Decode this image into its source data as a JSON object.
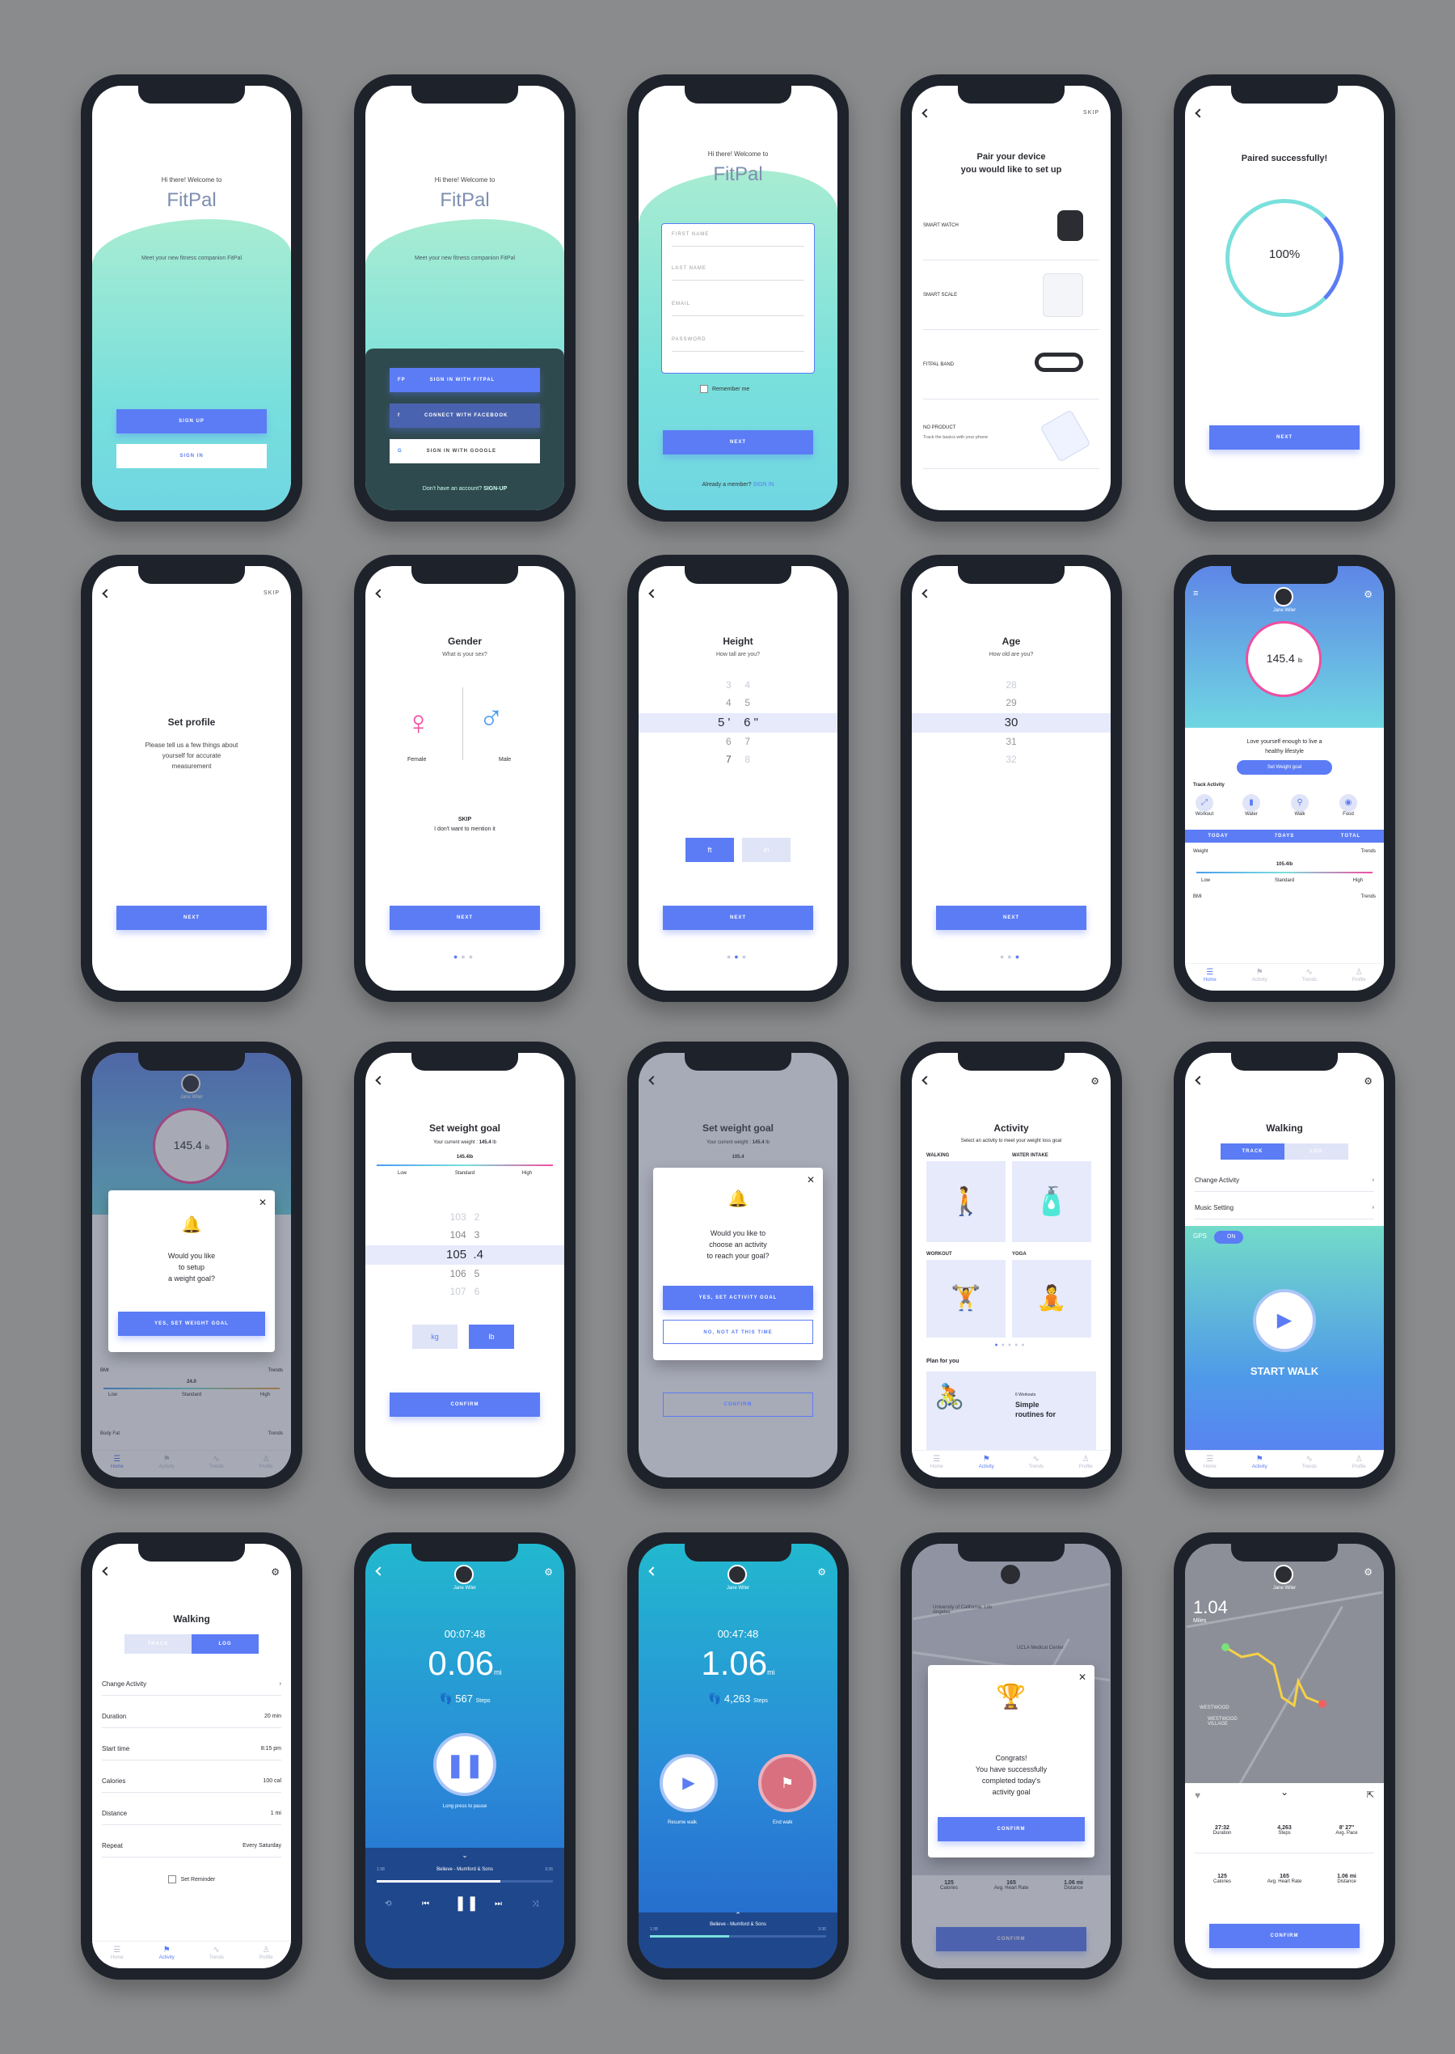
{
  "brand": {
    "name": "FitPal",
    "accent": "#5b7cf5",
    "dark": "#1e222b",
    "teal": "#7ae0dc",
    "pink": "#f04ea0"
  },
  "welcome": {
    "greeting": "Hi there! Welcome to",
    "tagline": "Meet your new fitness companion FitPal",
    "signup": "SIGN UP",
    "signin": "SIGN IN"
  },
  "social": {
    "fitpal_badge": "FP",
    "fitpal": "SIGN IN WITH FITPAL",
    "facebook_badge": "f",
    "facebook": "CONNECT WITH FACEBOOK",
    "google_badge": "G",
    "google": "SIGN IN WITH GOOGLE",
    "no_account": "Don't have an account?",
    "signup_link": "SIGN-UP"
  },
  "signup_form": {
    "first_name": "FIRST NAME",
    "last_name": "LAST NAME",
    "email": "EMAIL",
    "password": "PASSWORD",
    "remember": "Remember me",
    "next": "NEXT",
    "member": "Already a member?",
    "signin_link": "SIGN IN"
  },
  "pair": {
    "title_1": "Pair your device",
    "title_2": "you would like to set up",
    "skip": "SKIP",
    "items": [
      "SMART WATCH",
      "SMART SCALE",
      "FITPAL BAND",
      "NO PRODUCT"
    ],
    "no_product_sub": "Track the basics with your phone"
  },
  "paired": {
    "title": "Paired successfully!",
    "percent": "100%",
    "percent_value": 100,
    "next": "NEXT"
  },
  "set_profile": {
    "skip": "SKIP",
    "title": "Set profile",
    "text_1": "Please tell us a few things about",
    "text_2": "yourself for accurate",
    "text_3": "measurement",
    "next": "NEXT"
  },
  "gender": {
    "title": "Gender",
    "question": "What is your sex?",
    "female": "Female",
    "male": "Male",
    "skip": "SKIP",
    "skip_sub": "I don't want to mention it",
    "next": "NEXT"
  },
  "height": {
    "title": "Height",
    "question": "How tall are you?",
    "rows": [
      [
        "3",
        "4"
      ],
      [
        "4",
        "5"
      ],
      [
        "5 '",
        "6 \""
      ],
      [
        "6",
        "7"
      ],
      [
        "7",
        "8"
      ]
    ],
    "unit_ft": "ft",
    "unit_in": "in",
    "next": "NEXT"
  },
  "age": {
    "title": "Age",
    "question": "How old are you?",
    "values": [
      "28",
      "29",
      "30",
      "31",
      "32"
    ],
    "next": "NEXT"
  },
  "home": {
    "user": "Jane Wiler",
    "weight": "145.4",
    "unit": "lb",
    "message_1": "Love yourself enough to live a",
    "message_2": "healthy lifestyle",
    "goal_button": "Set Weight goal",
    "track_activity": "Track Activity",
    "activities": [
      "Workout",
      "Water",
      "Walk",
      "Food"
    ],
    "tabs": [
      "TODAY",
      "7DAYS",
      "TOTAL"
    ],
    "weight_label": "Weight",
    "trends": "Trends",
    "scale_value": "105.4",
    "scale_unit": "lb",
    "scale_labels": [
      "Low",
      "Standard",
      "High"
    ],
    "bmi": "BMI"
  },
  "nav": {
    "home": "Home",
    "activity": "Activity",
    "trends": "Trends",
    "profile": "Profile"
  },
  "goal_prompt": {
    "user": "Jane Wiler",
    "weight": "145.4",
    "unit": "lb",
    "q_1": "Would you like",
    "q_2": "to setup",
    "q_3": "a weight goal?",
    "yes": "YES, SET WEIGHT GOAL",
    "bmi": "BMI",
    "trends": "Trends",
    "bmi_value": "24.0",
    "scale_labels": [
      "Low",
      "Standard",
      "High"
    ],
    "body_fat": "Body Fat"
  },
  "weight_goal": {
    "title": "Set weight goal",
    "current_label": "Your current weight :",
    "current_value": "145.4",
    "current_unit": "lb",
    "scale_value": "145.4",
    "scale_unit": "lb",
    "scale_labels": [
      "Low",
      "Standard",
      "High"
    ],
    "rows": [
      [
        "103",
        "2"
      ],
      [
        "104",
        "3"
      ],
      [
        "105",
        ".4"
      ],
      [
        "106",
        "5"
      ],
      [
        "107",
        "6"
      ]
    ],
    "unit_kg": "kg",
    "unit_lb": "lb",
    "confirm": "CONFIRM"
  },
  "activity_prompt": {
    "title": "Set weight goal",
    "current_label": "Your current weight :",
    "current_value": "145.4",
    "current_unit": "lb",
    "scale_value": "105.4",
    "q_1": "Would you like to",
    "q_2": "choose an activity",
    "q_3": "to reach your goal?",
    "yes": "YES, SET ACTIVITY GOAL",
    "no": "NO, NOT AT THIS TIME",
    "confirm": "CONFIRM"
  },
  "activity": {
    "title": "Activity",
    "subtitle": "Select an activity to meet your weight loss goal",
    "cards": [
      "WALKING",
      "WATER INTAKE",
      "WORKOUT",
      "YOGA"
    ],
    "plan_title": "Plan for you",
    "plan_tag": "6 Workouts",
    "plan_name_1": "Simple",
    "plan_name_2": "routines for"
  },
  "walking": {
    "title": "Walking",
    "track": "TRACK",
    "log": "LOG",
    "change_activity": "Change Activity",
    "music": "Music Setting",
    "gps": "GPS",
    "gps_state": "ON",
    "start": "START WALK"
  },
  "walking_log": {
    "title": "Walking",
    "track": "TRACK",
    "log": "LOG",
    "rows": [
      [
        "Change Activity",
        ""
      ],
      [
        "Duration",
        "20 min"
      ],
      [
        "Start time",
        "8:15 pm"
      ],
      [
        "Calories",
        "100 cal"
      ],
      [
        "Distance",
        "1 mi"
      ],
      [
        "Repeat",
        "Every Saturday"
      ]
    ],
    "reminder": "Set Reminder"
  },
  "walk_live": {
    "user": "Jane Wiler",
    "time": "00:07:48",
    "distance": "0.06",
    "unit": "mi",
    "steps": "567",
    "steps_label": "Steps",
    "pause_hint": "Long press to pause",
    "song": "Believe - Mumford & Sons",
    "t_start": "1:38",
    "t_end": "3:36"
  },
  "walk_paused": {
    "user": "Jane Wiler",
    "time": "00:47:48",
    "distance": "1.06",
    "unit": "mi",
    "steps": "4,263",
    "steps_label": "Steps",
    "resume": "Resume walk",
    "end": "End walk",
    "song": "Believe - Mumford & Sons",
    "t_start": "1:38",
    "t_end": "3:36"
  },
  "congrats": {
    "map_labels": [
      "University of California, Los Angeles",
      "UCLA Medical Center"
    ],
    "line_1": "Congrats!",
    "line_2": "You have successfully",
    "line_3": "completed today's",
    "line_4": "activity goal",
    "confirm": "CONFIRM",
    "stats": [
      [
        "125",
        "Calories"
      ],
      [
        "165",
        "Avg. Heart Rate"
      ],
      [
        "1.06 mi",
        "Distance"
      ]
    ],
    "confirm_bottom": "CONFIRM"
  },
  "summary": {
    "user": "Jane Wiler",
    "distance": "1.04",
    "unit": "Miles",
    "map_labels": [
      "WESTWOOD",
      "WESTWOOD VILLAGE"
    ],
    "stats_top": [
      [
        "27:32",
        "Duration"
      ],
      [
        "4,263",
        "Steps"
      ],
      [
        "8' 27\"",
        "Avg. Pace"
      ]
    ],
    "stats_bottom": [
      [
        "125",
        "Calories"
      ],
      [
        "165",
        "Avg. Heart Rate"
      ],
      [
        "1.06 mi",
        "Distance"
      ]
    ],
    "confirm": "CONFIRM"
  }
}
